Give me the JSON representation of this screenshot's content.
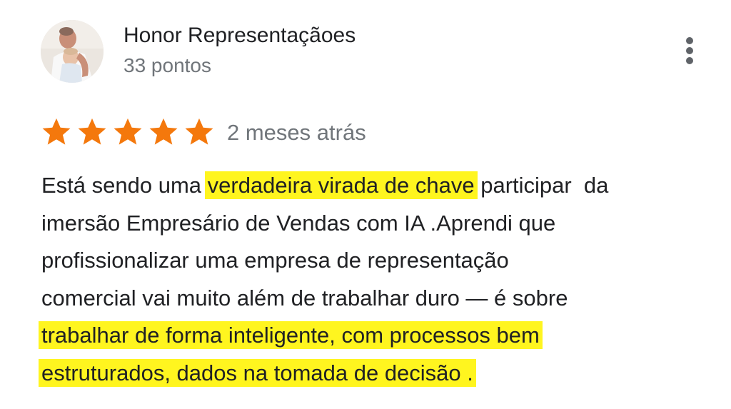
{
  "review": {
    "author": {
      "name": "Honor Representaçãoes",
      "points": "33 pontos",
      "avatar_icon": "profile-photo"
    },
    "menu_icon": "more-vert-icon",
    "rating": {
      "stars": 5,
      "max": 5,
      "star_color": "#f4780c"
    },
    "date": "2 meses atrás",
    "highlight_color": "#fff51f",
    "text": {
      "line1_before": "Está sendo uma ",
      "line1_highlight": "verdadeira virada de chave",
      "line1_after": " participar  da",
      "line2": "imersão Empresário de Vendas com IA .Aprendi que",
      "line3": "profissionalizar uma empresa de representação",
      "line4": "comercial vai muito além de trabalhar duro — é sobre",
      "line5_highlight": "trabalhar de forma inteligente, com processos bem",
      "line6_highlight": "estruturados, dados na tomada de decisão ."
    }
  }
}
